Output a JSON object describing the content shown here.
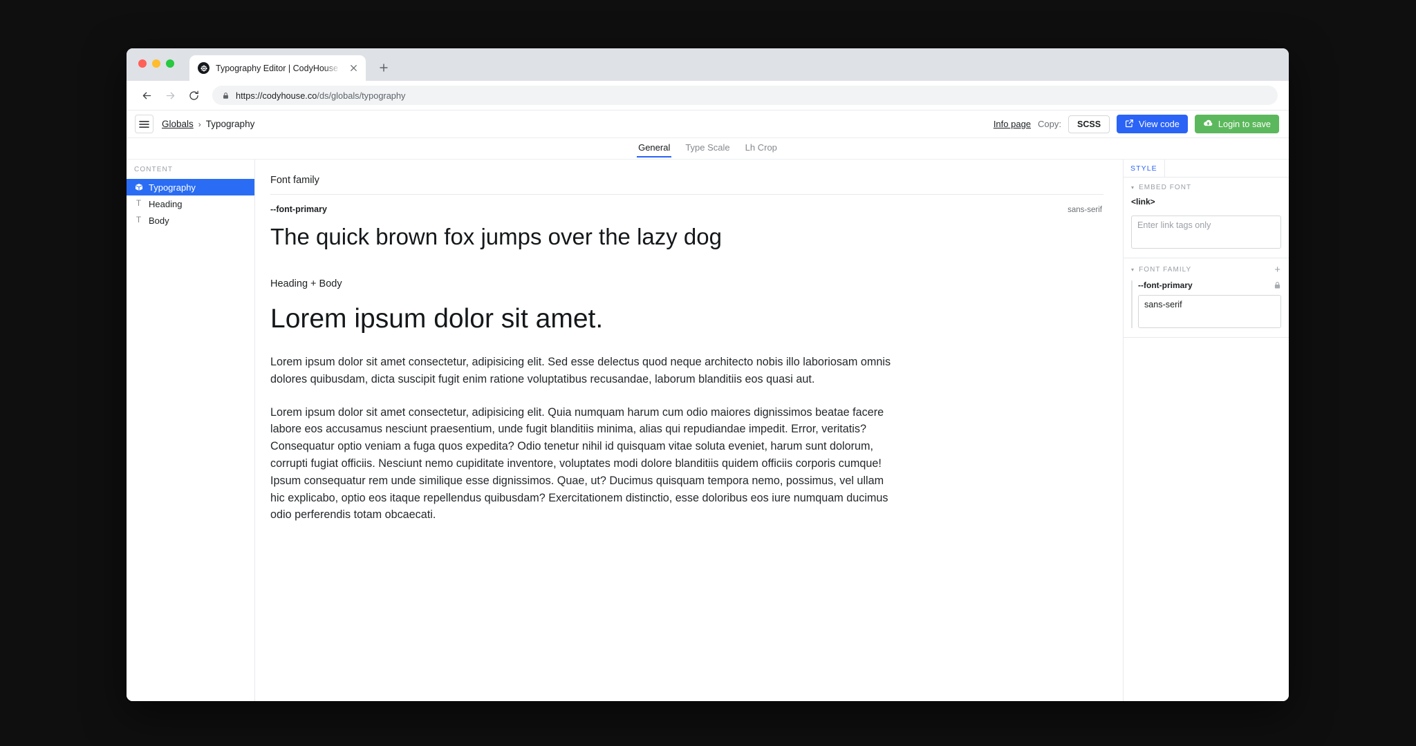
{
  "browser": {
    "tab_title": "Typography Editor | CodyHouse",
    "tab_favicon": "codyhouse-logo-icon",
    "close_label": "×",
    "new_tab_label": "+",
    "url_prefix": "https://codyhouse.co",
    "url_suffix": "/ds/globals/typography",
    "back_label": "←",
    "forward_label": "→",
    "reload_label": "⟳"
  },
  "header": {
    "menu_icon": "hamburger-icon",
    "breadcrumb_root": "Globals",
    "breadcrumb_separator": "›",
    "breadcrumb_current": "Typography",
    "info_page": "Info page",
    "copy_label": "Copy:",
    "copy_format": "SCSS",
    "view_code": "View code",
    "login_to_save": "Login to save",
    "accent_blue": "#2a63f6",
    "accent_green": "#5cb85c"
  },
  "tabs": [
    {
      "label": "General",
      "active": true
    },
    {
      "label": "Type Scale",
      "active": false
    },
    {
      "label": "Lh Crop",
      "active": false
    }
  ],
  "sidebar": {
    "title": "CONTENT",
    "items": [
      {
        "label": "Typography",
        "icon": "package-icon",
        "selected": true
      },
      {
        "label": "Heading",
        "icon": "text-icon",
        "selected": false
      },
      {
        "label": "Body",
        "icon": "text-icon",
        "selected": false
      }
    ]
  },
  "preview": {
    "font_family_section_label": "Font family",
    "token_name": "--font-primary",
    "token_value": "sans-serif",
    "font_sample": "The quick brown fox jumps over the lazy dog",
    "heading_body_section_label": "Heading + Body",
    "sample_heading": "Lorem ipsum dolor sit amet.",
    "paragraph_1": "Lorem ipsum dolor sit amet consectetur, adipisicing elit. Sed esse delectus quod neque architecto nobis illo laboriosam omnis dolores quibusdam, dicta suscipit fugit enim ratione voluptatibus recusandae, laborum blanditiis eos quasi aut.",
    "paragraph_2": "Lorem ipsum dolor sit amet consectetur, adipisicing elit. Quia numquam harum cum odio maiores dignissimos beatae facere labore eos accusamus nesciunt praesentium, unde fugit blanditiis minima, alias qui repudiandae impedit. Error, veritatis? Consequatur optio veniam a fuga quos expedita? Odio tenetur nihil id quisquam vitae soluta eveniet, harum sunt dolorum, corrupti fugiat officiis. Nesciunt nemo cupiditate inventore, voluptates modi dolore blanditiis quidem officiis corporis cumque! Ipsum consequatur rem unde similique esse dignissimos. Quae, ut? Ducimus quisquam tempora nemo, possimus, vel ullam hic explicabo, optio eos itaque repellendus quibusdam? Exercitationem distinctio, esse doloribus eos iure numquam ducimus odio perferendis totam obcaecati."
  },
  "style_panel": {
    "tab_label": "STYLE",
    "embed_font": {
      "section_title": "EMBED FONT",
      "caret": "▾",
      "field_label": "<link>",
      "textarea_value": "",
      "textarea_placeholder": "Enter link tags only"
    },
    "font_family": {
      "section_title": "FONT FAMILY",
      "caret": "▾",
      "add_label": "+",
      "property_name": "--font-primary",
      "lock_icon": "lock-icon",
      "textarea_value": "sans-serif",
      "textarea_placeholder": ""
    }
  }
}
